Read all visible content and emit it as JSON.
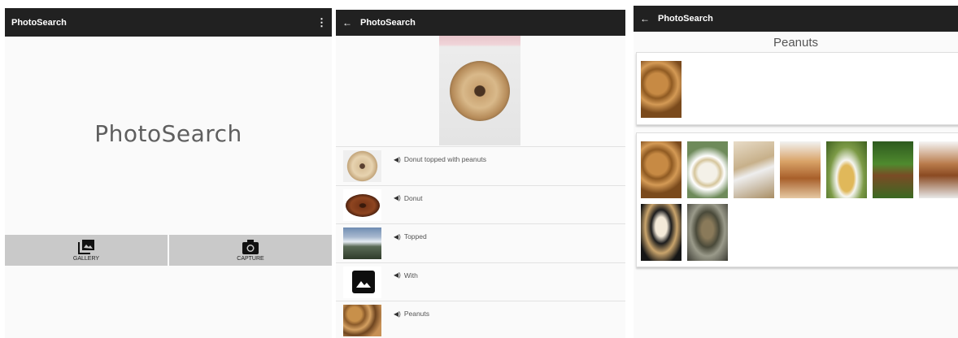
{
  "screen1": {
    "app_title": "PhotoSearch",
    "menu_icon": "overflow-menu-icon",
    "logo_text": "PhotoSearch",
    "buttons": [
      {
        "label": "GALLERY",
        "icon": "gallery-icon"
      },
      {
        "label": "CAPTURE",
        "icon": "camera-icon"
      }
    ]
  },
  "screen2": {
    "back_glyph": "←",
    "app_title": "PhotoSearch",
    "speaker_glyph": "🔊",
    "results": [
      {
        "label": "Donut topped with peanuts"
      },
      {
        "label": "Donut"
      },
      {
        "label": "Topped"
      },
      {
        "label": "With"
      },
      {
        "label": "Peanuts"
      }
    ]
  },
  "screen3": {
    "back_glyph": "←",
    "app_title": "PhotoSearch",
    "page_title": "Peanuts",
    "image_count": 9
  }
}
